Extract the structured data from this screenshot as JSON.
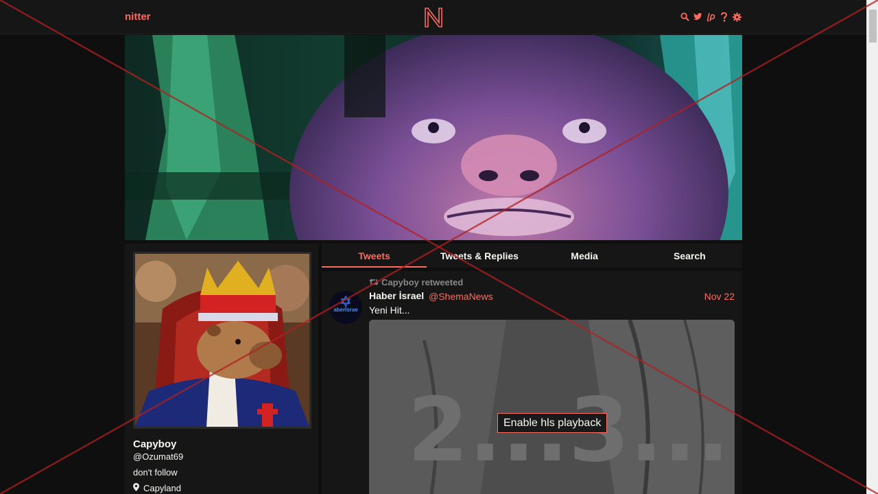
{
  "navbar": {
    "brand": "nitter",
    "logo_letter": "N",
    "icons": [
      "search-icon",
      "twitter-icon",
      "liberapay-icon",
      "help-icon",
      "gear-icon"
    ]
  },
  "tabs": [
    {
      "label": "Tweets",
      "active": true
    },
    {
      "label": "Tweets & Replies",
      "active": false
    },
    {
      "label": "Media",
      "active": false
    },
    {
      "label": "Search",
      "active": false
    }
  ],
  "profile": {
    "name": "Capyboy",
    "handle": "@Ozumat69",
    "bio": "don't follow",
    "location": "Capyland"
  },
  "tweet": {
    "retweet_label": "Capyboy retweeted",
    "author": "Haber İsrael",
    "handle": "@ShemaNews",
    "date": "Nov 22",
    "text": "Yeni Hit...",
    "avatar_text": "aberİsrae",
    "media_overlay_text": "2...3...",
    "hls_button": "Enable hls playback"
  },
  "colors": {
    "accent": "#ff6c60",
    "background": "#0f0f0f",
    "panel": "#161616",
    "muted": "#888889"
  }
}
